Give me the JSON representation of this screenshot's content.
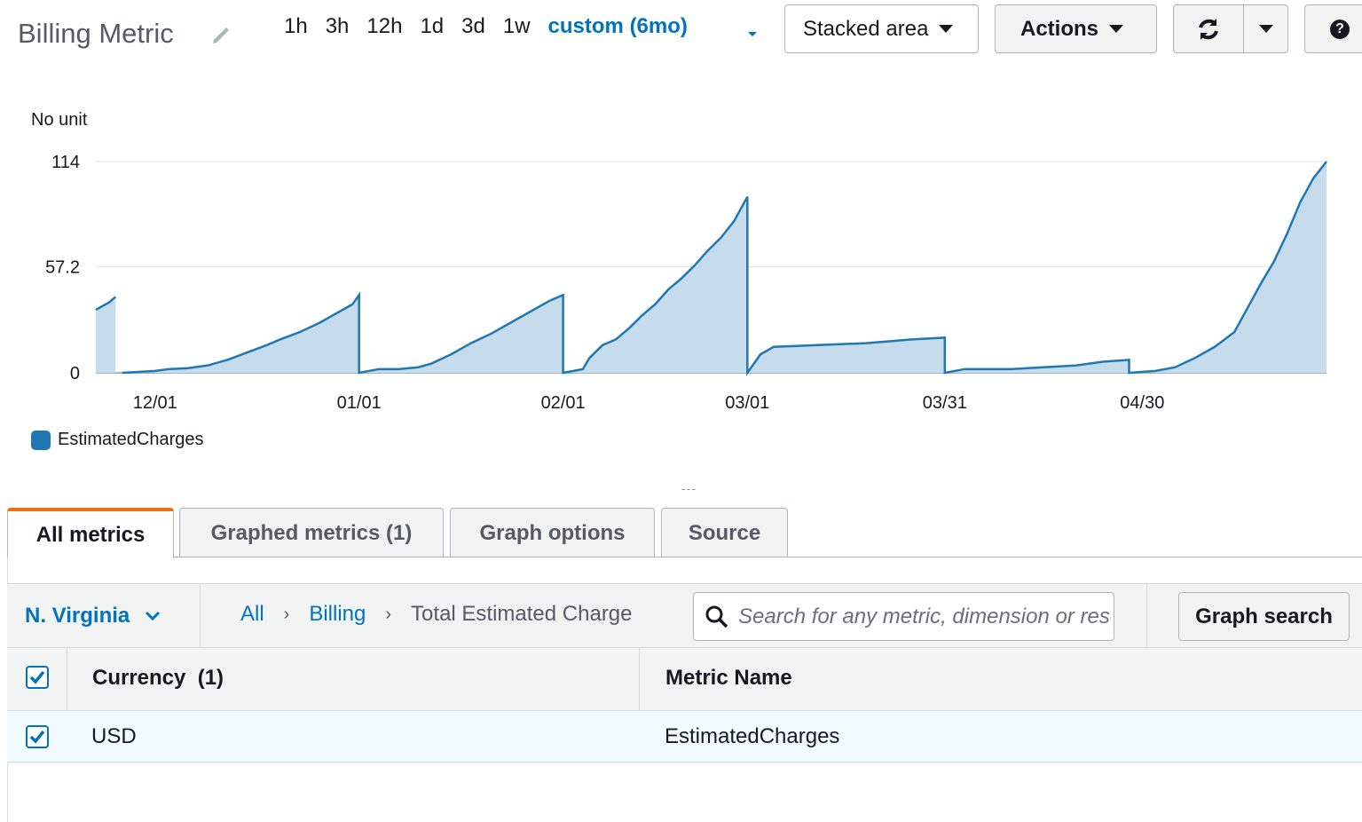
{
  "header": {
    "title": "Billing Metric",
    "time_ranges": [
      "1h",
      "3h",
      "12h",
      "1d",
      "3d",
      "1w"
    ],
    "active_range": "custom (6mo)",
    "chart_type_label": "Stacked area",
    "actions_label": "Actions",
    "help_label": "?"
  },
  "chart_data": {
    "type": "area",
    "title": "",
    "ylabel": "No unit",
    "ylim": [
      0,
      114
    ],
    "yticks": [
      "0",
      "57.2",
      "114"
    ],
    "xticks": [
      "12/01",
      "01/01",
      "02/01",
      "03/01",
      "03/31",
      "04/30"
    ],
    "x_axis": "date",
    "grid": "horizontal",
    "legend_position": "bottom-left",
    "color": "#1f77b4",
    "fill": "#c6dcec",
    "series": [
      {
        "name": "EstimatedCharges",
        "points": [
          [
            "2022-11-22",
            34
          ],
          [
            "2022-11-23",
            36
          ],
          [
            "2022-11-24",
            38
          ],
          [
            "2022-11-25",
            41
          ],
          [
            "2022-11-26",
            null
          ],
          [
            "2022-11-26",
            0
          ],
          [
            "2022-12-01",
            1
          ],
          [
            "2022-12-03",
            2
          ],
          [
            "2022-12-06",
            2.5
          ],
          [
            "2022-12-09",
            4
          ],
          [
            "2022-12-12",
            7
          ],
          [
            "2022-12-15",
            11
          ],
          [
            "2022-12-18",
            15
          ],
          [
            "2022-12-20",
            18
          ],
          [
            "2022-12-23",
            22
          ],
          [
            "2022-12-26",
            27
          ],
          [
            "2022-12-29",
            33
          ],
          [
            "2022-12-31",
            37
          ],
          [
            "2023-01-01",
            42
          ],
          [
            "2023-01-01",
            0
          ],
          [
            "2023-01-04",
            2
          ],
          [
            "2023-01-07",
            2
          ],
          [
            "2023-01-10",
            3
          ],
          [
            "2023-01-12",
            5
          ],
          [
            "2023-01-15",
            10
          ],
          [
            "2023-01-18",
            16
          ],
          [
            "2023-01-21",
            21
          ],
          [
            "2023-01-24",
            27
          ],
          [
            "2023-01-27",
            33
          ],
          [
            "2023-01-30",
            39
          ],
          [
            "2023-02-01",
            42
          ],
          [
            "2023-02-01",
            0
          ],
          [
            "2023-02-04",
            2
          ],
          [
            "2023-02-05",
            8
          ],
          [
            "2023-02-07",
            15
          ],
          [
            "2023-02-09",
            18
          ],
          [
            "2023-02-11",
            24
          ],
          [
            "2023-02-13",
            31
          ],
          [
            "2023-02-15",
            37
          ],
          [
            "2023-02-17",
            45
          ],
          [
            "2023-02-19",
            51
          ],
          [
            "2023-02-21",
            58
          ],
          [
            "2023-02-23",
            66
          ],
          [
            "2023-02-25",
            73
          ],
          [
            "2023-02-27",
            82
          ],
          [
            "2023-03-01",
            95
          ],
          [
            "2023-03-01",
            0
          ],
          [
            "2023-03-03",
            10
          ],
          [
            "2023-03-05",
            14
          ],
          [
            "2023-03-12",
            15
          ],
          [
            "2023-03-19",
            16
          ],
          [
            "2023-03-26",
            18
          ],
          [
            "2023-03-31",
            19
          ],
          [
            "2023-03-31",
            0
          ],
          [
            "2023-04-03",
            2
          ],
          [
            "2023-04-10",
            2
          ],
          [
            "2023-04-15",
            3
          ],
          [
            "2023-04-20",
            4
          ],
          [
            "2023-04-24",
            6
          ],
          [
            "2023-04-28",
            7
          ],
          [
            "2023-04-28",
            0
          ],
          [
            "2023-05-02",
            1
          ],
          [
            "2023-05-05",
            3
          ],
          [
            "2023-05-08",
            8
          ],
          [
            "2023-05-11",
            14
          ],
          [
            "2023-05-14",
            22
          ],
          [
            "2023-05-16",
            35
          ],
          [
            "2023-05-18",
            48
          ],
          [
            "2023-05-20",
            60
          ],
          [
            "2023-05-22",
            75
          ],
          [
            "2023-05-24",
            92
          ],
          [
            "2023-05-26",
            105
          ],
          [
            "2023-05-28",
            114
          ]
        ]
      }
    ]
  },
  "legend": {
    "series_name": "EstimatedCharges"
  },
  "drag_handle": "---",
  "tabs": [
    {
      "label": "All metrics"
    },
    {
      "label": "Graphed metrics (1)"
    },
    {
      "label": "Graph options"
    },
    {
      "label": "Source"
    }
  ],
  "browser": {
    "region": "N. Virginia",
    "breadcrumb": [
      "All",
      "Billing",
      "Total Estimated Charge"
    ],
    "search_placeholder": "Search for any metric, dimension or resource id",
    "graph_search_label": "Graph search",
    "columns": [
      "Currency  (1)",
      "Metric Name"
    ],
    "rows": [
      {
        "currency": "USD",
        "metric_name": "EstimatedCharges",
        "checked": true
      }
    ]
  }
}
